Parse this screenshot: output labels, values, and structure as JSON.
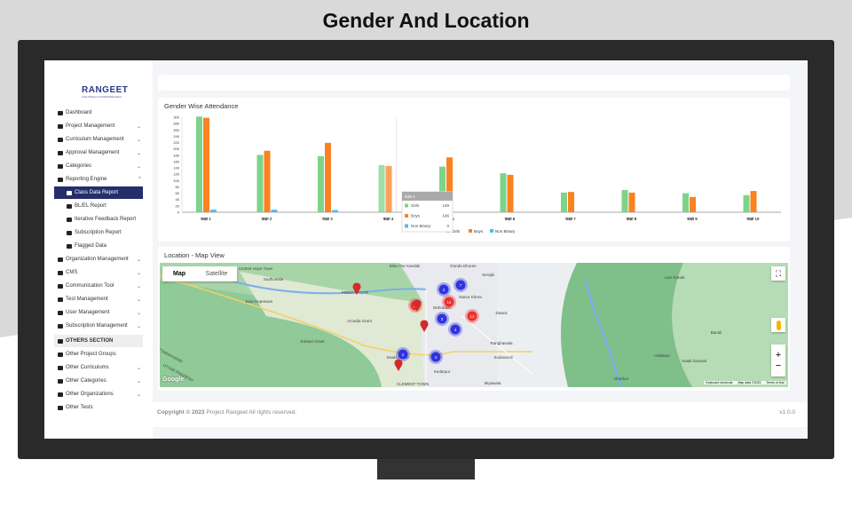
{
  "slide_title": "Gender And Location",
  "sidebar": {
    "logo": "RANGEET",
    "logo_tagline": "Your Partner in Child Education",
    "items": [
      {
        "label": "Dashboard",
        "icon": "home-icon",
        "chevron": ""
      },
      {
        "label": "Project Management",
        "icon": "list-icon",
        "chevron": "down"
      },
      {
        "label": "Curriculum Management",
        "icon": "book-icon",
        "chevron": "down"
      },
      {
        "label": "Approval Management",
        "icon": "approval-icon",
        "chevron": "down"
      },
      {
        "label": "Categories",
        "icon": "tags-icon",
        "chevron": "down"
      },
      {
        "label": "Reporting Engine",
        "icon": "chart-line-icon",
        "chevron": "up"
      }
    ],
    "sub_items": [
      {
        "label": "Class Data Report",
        "icon": "bar-chart-icon",
        "active": true
      },
      {
        "label": "BL/EL Report",
        "icon": "sitemap-icon"
      },
      {
        "label": "Iterative Feedback Report",
        "icon": "chart-area-icon"
      },
      {
        "label": "Subscription Report",
        "icon": "user-tie-icon"
      },
      {
        "label": "Flagged Data",
        "icon": "flag-icon"
      }
    ],
    "items2": [
      {
        "label": "Organization Management",
        "icon": "list-icon",
        "chevron": "down"
      },
      {
        "label": "CMS",
        "icon": "folder-icon",
        "chevron": "down"
      },
      {
        "label": "Communication Tool",
        "icon": "comment-icon",
        "chevron": "down"
      },
      {
        "label": "Test Management",
        "icon": "question-icon",
        "chevron": "down"
      },
      {
        "label": "User Management",
        "icon": "users-icon",
        "chevron": "down"
      },
      {
        "label": "Subscription Management",
        "icon": "subscription-icon",
        "chevron": "down"
      }
    ],
    "others_section": "OTHERS SECTION",
    "others": [
      {
        "label": "Other Project Groups",
        "icon": "layers-icon",
        "chevron": ""
      },
      {
        "label": "Other Curriculums",
        "icon": "book-icon",
        "chevron": "down"
      },
      {
        "label": "Other Categories",
        "icon": "tags-icon",
        "chevron": "down"
      },
      {
        "label": "Other Organizations",
        "icon": "list-icon",
        "chevron": "down"
      },
      {
        "label": "Other Tests",
        "icon": "test-icon",
        "chevron": ""
      }
    ]
  },
  "chart_card": {
    "title": "Gender Wise Attendance"
  },
  "chart_data": {
    "type": "bar",
    "title": "Gender Wise Attendance",
    "categories": [
      "कक्षा 1",
      "कक्षा 2",
      "कक्षा 3",
      "कक्षा 4",
      "कक्षा 5",
      "कक्षा 6",
      "कक्षा 7",
      "कक्षा 8",
      "कक्षा 9",
      "कक्षा 10"
    ],
    "series": [
      {
        "name": "Girls",
        "color": "#7ed389",
        "values": [
          302,
          181,
          177,
          149,
          144,
          123,
          62,
          70,
          60,
          54
        ]
      },
      {
        "name": "Boys",
        "color": "#fa8221",
        "values": [
          298,
          194,
          219,
          146,
          173,
          118,
          64,
          62,
          48,
          67
        ]
      },
      {
        "name": "Non Binary",
        "color": "#52b9f5",
        "values": [
          8,
          8,
          7,
          0,
          0,
          0,
          0,
          0,
          0,
          0
        ]
      }
    ],
    "ylim": [
      0,
      300
    ],
    "yticks": [
      0,
      20,
      40,
      60,
      80,
      100,
      120,
      140,
      160,
      180,
      200,
      220,
      240,
      260,
      280,
      300
    ],
    "grid": false,
    "legend": "bottom",
    "tooltip": {
      "title": "कक्षा 4",
      "rows": [
        {
          "name": "Girls",
          "value": "149"
        },
        {
          "name": "Boys",
          "value": "146"
        },
        {
          "name": "Non Binary",
          "value": "0"
        }
      ]
    }
  },
  "map_card": {
    "title": "Location - Map View",
    "map_tab": "Map",
    "satellite_tab": "Satellite",
    "places": [
      "Central Hope Town",
      "Banghiwala",
      "Sudhowala",
      "PREM NAGAR",
      "East Hopetown",
      "Arcadia Grant",
      "Karbari Grant",
      "UTTARAKHAND",
      "UTTAR PRADESH",
      "Bilas Pur Kandali",
      "Dehradun",
      "Sewla Kalan",
      "Kedarpur",
      "CLEMENT TOWN",
      "Donda Dhoran",
      "Nanur Khera",
      "Serajki",
      "Dwara",
      "Ranghawala",
      "Sodasaroli",
      "Miyawala",
      "Lam Kande",
      "Banali",
      "Holdwari",
      "Satali Gairwal",
      "Dharkot"
    ],
    "clusters": [
      {
        "count": "2",
        "color": "blue"
      },
      {
        "count": "7",
        "color": "blue"
      },
      {
        "count": "15",
        "color": "red"
      },
      {
        "count": "14",
        "color": "red"
      },
      {
        "count": "12",
        "color": "red"
      },
      {
        "count": "3",
        "color": "blue"
      },
      {
        "count": "4",
        "color": "blue"
      },
      {
        "count": "2",
        "color": "blue"
      },
      {
        "count": "4",
        "color": "blue"
      }
    ],
    "attribution": {
      "google": "Google",
      "shortcuts": "Keyboard shortcuts",
      "map_data": "Map data ©2023",
      "terms": "Terms of Use"
    }
  },
  "footer": {
    "copyright_bold": "Copyright © 2023",
    "copyright_rest": " Project Rangeet All rights reserved.",
    "version": "v1.0.0"
  }
}
